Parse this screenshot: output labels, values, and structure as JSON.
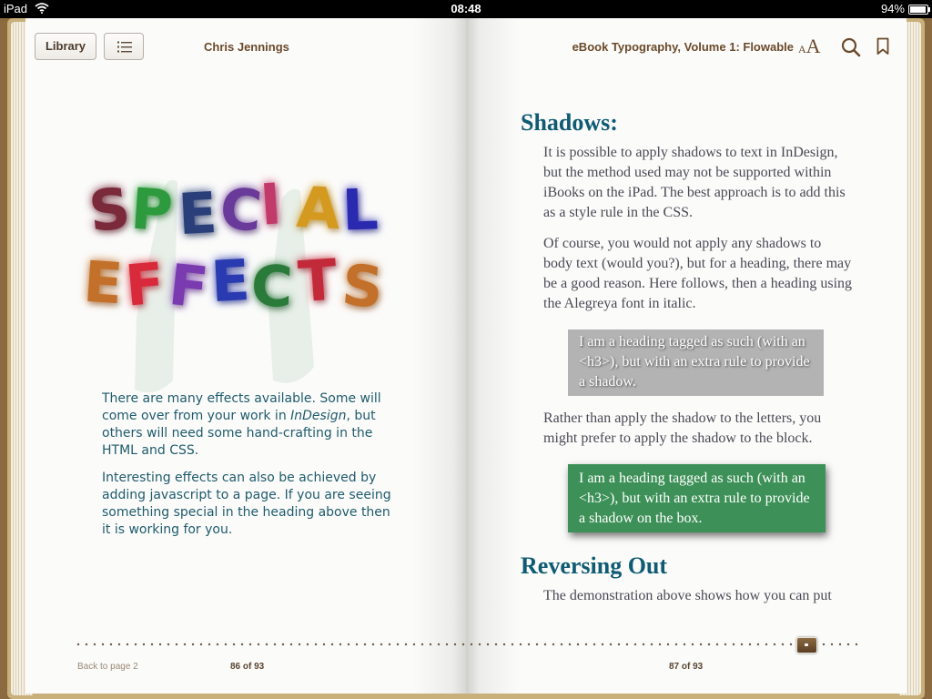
{
  "status_bar": {
    "carrier": "iPad",
    "time": "08:48",
    "battery_percent": "94%",
    "battery_level": 0.94
  },
  "toolbar": {
    "library_label": "Library",
    "author": "Chris Jennings",
    "book_title": "eBook Typography, Volume 1: Flowable",
    "font_size_small": "A",
    "font_size_large": "A",
    "icons": [
      "wifi-icon",
      "battery-icon",
      "table-of-contents-icon",
      "font-size-icon",
      "search-icon",
      "bookmark-icon"
    ]
  },
  "left_page": {
    "title_art": {
      "line1": [
        "S",
        "P",
        "E",
        "C",
        "I",
        "A",
        "L"
      ],
      "line2": [
        "E",
        "F",
        "F",
        "E",
        "C",
        "T",
        "S"
      ],
      "colors": [
        "#7a2a3a",
        "#2e9a3e",
        "#2a3f7a",
        "#6a3a9a",
        "#c23a6a",
        "#d49a20",
        "#2a2ab0",
        "#c2702a",
        "#d82a3a",
        "#7a3ab0",
        "#2a3ab0",
        "#2a7a3a",
        "#c22a3a",
        "#c2702a"
      ]
    },
    "para1_a": "There are many effects available. Some will come over from your work in ",
    "para1_em": "InDesign",
    "para1_b": ", but others will need some hand-crafting in the HTML and CSS.",
    "para2": "Interesting effects can also be achieved by adding javascript to a page. If you are seeing something special in the heading above then it is working for you.",
    "back_link": "Back to page 2",
    "page_number": "86 of 93"
  },
  "right_page": {
    "heading_shadows": "Shadows:",
    "para1": "It is possible to apply shadows to text in InDesign, but the method used may not be supported within iBooks on the iPad. The best approach is to add this as a style rule in the CSS.",
    "para2": "Of course, you would not apply any shadows to body text (would you?), but for a heading, there may be a good reason. Here follows, then a heading using the Alegreya font in italic.",
    "grey_box": "I am a heading tagged as such (with an <h3>), but with an extra rule to provide a shadow.",
    "para3": "Rather than apply the shadow to the letters, you might prefer to apply the shadow to the block.",
    "green_box": "I am a heading tagged as such (with an <h3>), but with an extra rule to provide a shadow on the box.",
    "heading_reversing": "Reversing Out",
    "para4": "The demonstration above shows how you can put",
    "page_number": "87 of 93"
  },
  "scrubber": {
    "current_page": 87,
    "total_pages": 93
  },
  "colors": {
    "heading_teal": "#0f5b73",
    "left_text": "#1f5b6b",
    "green_box": "#3d9158",
    "grey_box": "#b3b3b3",
    "toolbar_brown": "#6b4a2a"
  }
}
